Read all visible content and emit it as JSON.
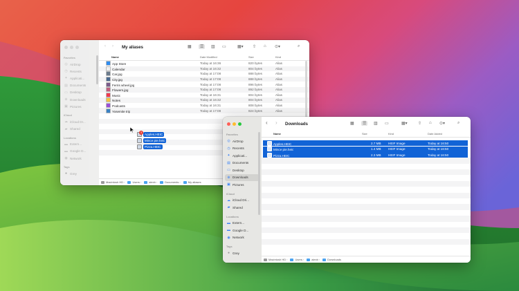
{
  "back_window": {
    "title": "My aliases",
    "sidebar": [
      {
        "section": "Favorites",
        "items": [
          {
            "label": "AirDrop",
            "icon": "airdrop-icon"
          },
          {
            "label": "Recents",
            "icon": "clock-icon"
          },
          {
            "label": "Applicati...",
            "icon": "apps-icon"
          },
          {
            "label": "Documents",
            "icon": "doc-icon"
          },
          {
            "label": "Desktop",
            "icon": "desktop-icon"
          },
          {
            "label": "Downloads",
            "icon": "download-icon"
          },
          {
            "label": "Pictures",
            "icon": "photo-icon"
          }
        ]
      },
      {
        "section": "iCloud",
        "items": [
          {
            "label": "iCloud Dr...",
            "icon": "cloud-icon"
          },
          {
            "label": "Shared",
            "icon": "shared-folder-icon"
          }
        ]
      },
      {
        "section": "Locations",
        "items": [
          {
            "label": "Extern...",
            "icon": "disk-icon"
          },
          {
            "label": "Google D...",
            "icon": "disk-icon"
          },
          {
            "label": "Network",
            "icon": "network-icon"
          }
        ]
      },
      {
        "section": "Tags",
        "items": [
          {
            "label": "Grey",
            "icon": "tag-dot-icon"
          }
        ]
      }
    ],
    "columns": [
      "Name",
      "Date Modified",
      "Size",
      "Kind"
    ],
    "rows": [
      {
        "name": "App Store",
        "date": "Today at 16:36",
        "size": "820 bytes",
        "kind": "Alias",
        "color": "#2f8cf0"
      },
      {
        "name": "Calendar",
        "date": "Today at 16:32",
        "size": "804 bytes",
        "kind": "Alias",
        "color": "#f0f0f0"
      },
      {
        "name": "Car.jpg",
        "date": "Today at 17:08",
        "size": "888 bytes",
        "kind": "Alias",
        "color": "#6b7b8c"
      },
      {
        "name": "City.jpg",
        "date": "Today at 17:08",
        "size": "888 bytes",
        "kind": "Alias",
        "color": "#4a6a8f"
      },
      {
        "name": "Ferris wheel.jpg",
        "date": "Today at 17:08",
        "size": "896 bytes",
        "kind": "Alias",
        "color": "#7a5c8a"
      },
      {
        "name": "Flowers.jpg",
        "date": "Today at 17:08",
        "size": "892 bytes",
        "kind": "Alias",
        "color": "#c06080"
      },
      {
        "name": "Music",
        "date": "Today at 16:31",
        "size": "804 bytes",
        "kind": "Alias",
        "color": "#f2394f"
      },
      {
        "name": "Notes",
        "date": "Today at 16:32",
        "size": "804 bytes",
        "kind": "Alias",
        "color": "#f5c542"
      },
      {
        "name": "Podcasts",
        "date": "Today at 16:31",
        "size": "808 bytes",
        "kind": "Alias",
        "color": "#9b4fd8"
      },
      {
        "name": "Yosemite trip",
        "date": "Today at 17:08",
        "size": "824 bytes",
        "kind": "Alias",
        "color": "#3b82c4"
      }
    ],
    "path": [
      "Macintosh HD",
      "Users",
      "alexb",
      "Documents",
      "My aliases"
    ]
  },
  "front_window": {
    "title": "Downloads",
    "sidebar": [
      {
        "section": "Favorites",
        "items": [
          {
            "label": "AirDrop",
            "icon": "airdrop-icon"
          },
          {
            "label": "Recents",
            "icon": "clock-icon"
          },
          {
            "label": "Applicati...",
            "icon": "apps-icon"
          },
          {
            "label": "Documents",
            "icon": "doc-icon"
          },
          {
            "label": "Desktop",
            "icon": "desktop-icon"
          },
          {
            "label": "Downloads",
            "icon": "download-icon",
            "selected": true
          },
          {
            "label": "Pictures",
            "icon": "photo-icon"
          }
        ]
      },
      {
        "section": "iCloud",
        "items": [
          {
            "label": "iCloud Dri...",
            "icon": "cloud-icon"
          },
          {
            "label": "Shared",
            "icon": "shared-folder-icon"
          }
        ]
      },
      {
        "section": "Locations",
        "items": [
          {
            "label": "Extern...",
            "icon": "disk-icon"
          },
          {
            "label": "Google D...",
            "icon": "disk-icon"
          },
          {
            "label": "Network",
            "icon": "network-icon"
          }
        ]
      },
      {
        "section": "Tags",
        "items": [
          {
            "label": "Grey",
            "icon": "tag-dot-icon"
          }
        ]
      }
    ],
    "columns": [
      "Name",
      "Size",
      "Kind",
      "Date Added"
    ],
    "rows": [
      {
        "name": "Apples.HEIC",
        "size": "2.7 MB",
        "kind": "HEIF Image",
        "date": "Today at 16:50"
      },
      {
        "name": "Mince pie.heic",
        "size": "1.4 MB",
        "kind": "HEIF Image",
        "date": "Today at 16:50"
      },
      {
        "name": "Pizza.HEIC",
        "size": "2.3 MB",
        "kind": "HEIF Image",
        "date": "Today at 16:50"
      }
    ],
    "path": [
      "Macintosh HD",
      "Users",
      "alexb",
      "Downloads"
    ]
  },
  "drag": {
    "count": "3",
    "items": [
      "Apples.HEIC",
      "Mince pie.heic",
      "Pizza.HEIC"
    ]
  },
  "colors": {
    "selection": "#1163d6",
    "close": "#ff5f57",
    "minimize": "#febc2e",
    "zoom": "#28c840",
    "folder": "#4aa3f0"
  }
}
